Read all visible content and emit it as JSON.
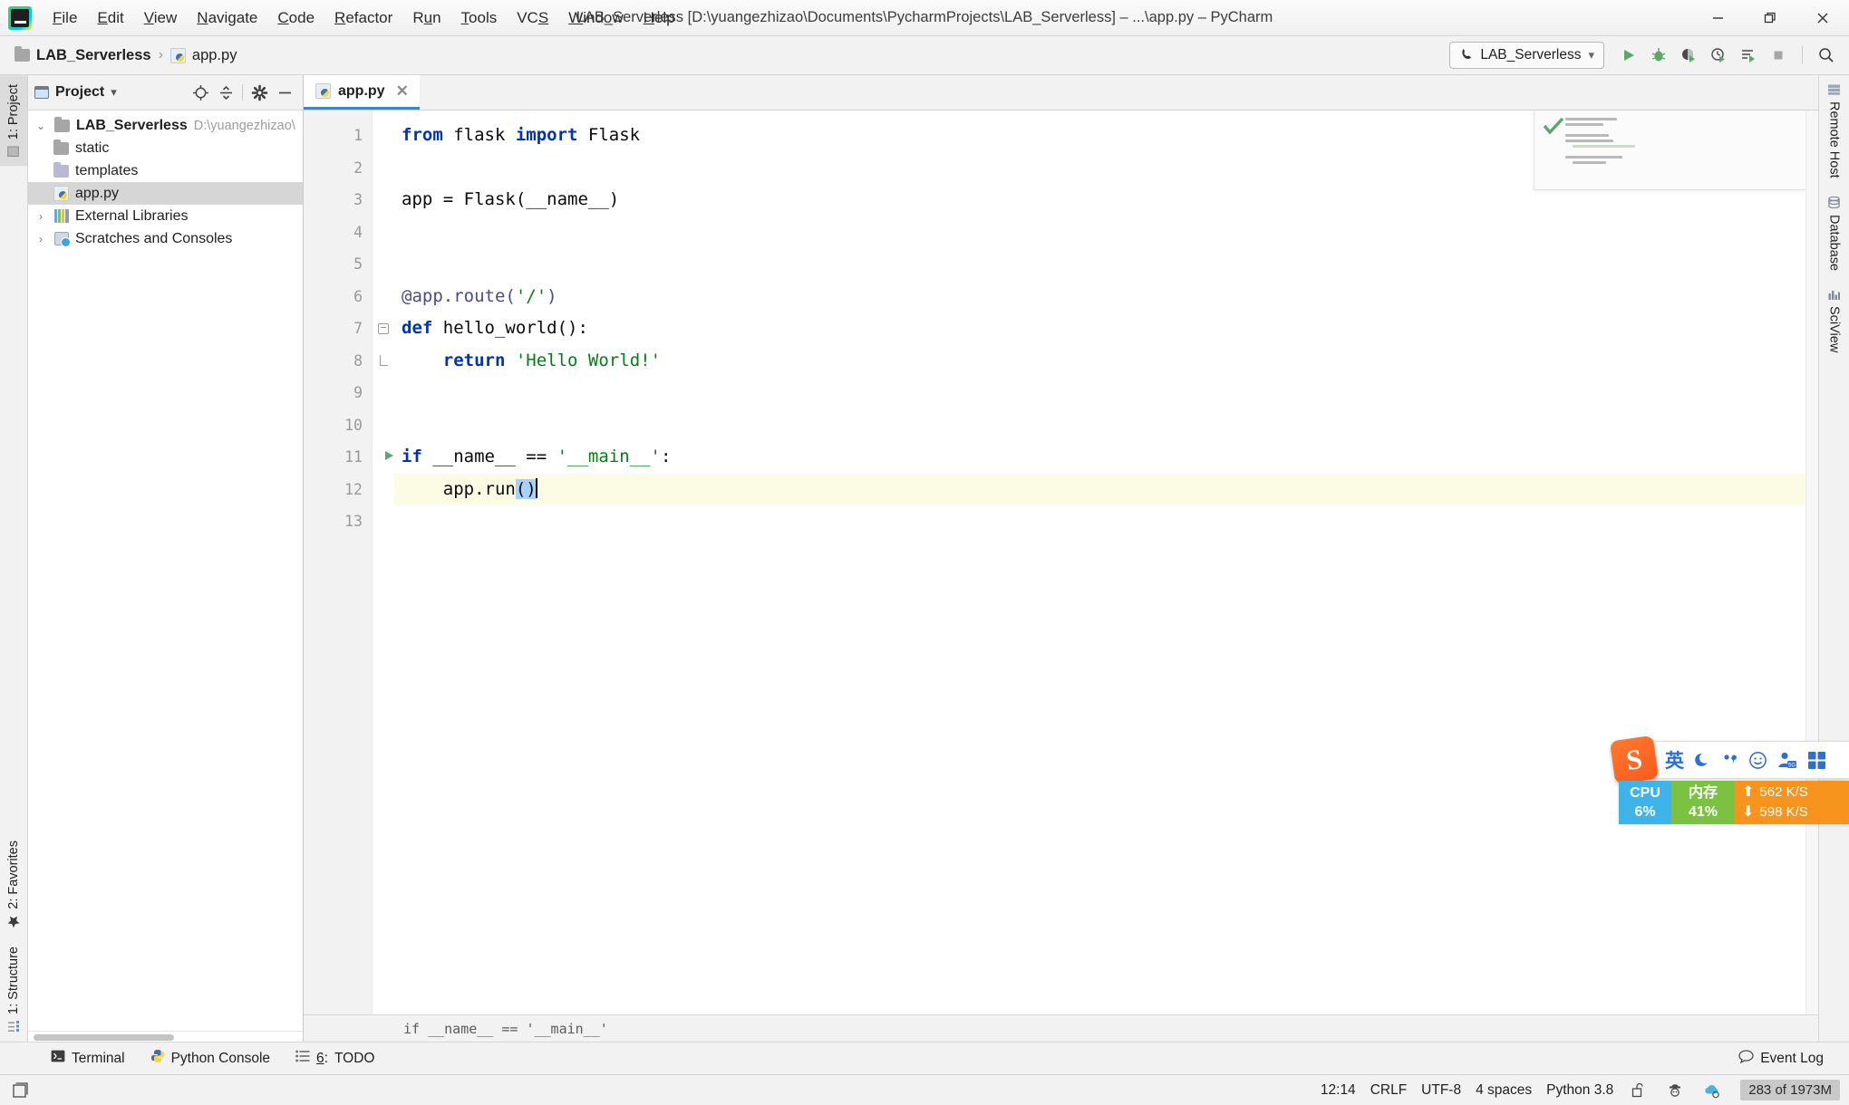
{
  "window": {
    "title": "LAB_Serverless [D:\\yuangezhizao\\Documents\\PycharmProjects\\LAB_Serverless] – ...\\app.py – PyCharm",
    "minimize": "–",
    "maximize": "❐",
    "close": "✕"
  },
  "menubar": {
    "items": [
      {
        "label": "File",
        "mnemonic": "F"
      },
      {
        "label": "Edit",
        "mnemonic": "E"
      },
      {
        "label": "View",
        "mnemonic": "V"
      },
      {
        "label": "Navigate",
        "mnemonic": "N"
      },
      {
        "label": "Code",
        "mnemonic": "C"
      },
      {
        "label": "Refactor",
        "mnemonic": "R"
      },
      {
        "label": "Run",
        "mnemonic": "u"
      },
      {
        "label": "Tools",
        "mnemonic": "T"
      },
      {
        "label": "VCS",
        "mnemonic": "S"
      },
      {
        "label": "Window",
        "mnemonic": "W"
      },
      {
        "label": "Help",
        "mnemonic": "H"
      }
    ]
  },
  "navbar": {
    "crumbs": [
      {
        "label": "LAB_Serverless",
        "icon": "folder-icon"
      },
      {
        "label": "app.py",
        "icon": "python-file-icon"
      }
    ],
    "separator": "›",
    "run_configuration": "LAB_Serverless",
    "toolbar_icons": [
      "run-icon",
      "debug-icon",
      "run-coverage-icon",
      "profile-icon",
      "run-with-console-icon",
      "stop-icon",
      "search-everywhere-icon"
    ]
  },
  "left_strip": {
    "top": [
      {
        "label": "1: Project",
        "active": true
      }
    ],
    "bottom": [
      {
        "label": "2: Favorites",
        "active": false
      },
      {
        "label": "1: Structure",
        "active": false
      }
    ]
  },
  "right_strip": {
    "items": [
      {
        "label": "Remote Host"
      },
      {
        "label": "Database"
      },
      {
        "label": "SciView"
      }
    ]
  },
  "project_panel": {
    "title": "Project",
    "dropdown_caret": "▾",
    "header_icons": [
      "locate-icon",
      "collapse-all-icon",
      "settings-gear-icon",
      "hide-icon"
    ],
    "tree": [
      {
        "label": "LAB_Serverless",
        "path": "D:\\yuangezhizao\\",
        "icon": "folder-icon",
        "twisty": "⌄",
        "indent": 0,
        "bold": true,
        "selected": false
      },
      {
        "label": "static",
        "path": "",
        "icon": "folder-icon",
        "twisty": "",
        "indent": 1,
        "bold": false,
        "selected": false
      },
      {
        "label": "templates",
        "path": "",
        "icon": "folder-blue-icon",
        "twisty": "",
        "indent": 1,
        "bold": false,
        "selected": false
      },
      {
        "label": "app.py",
        "path": "",
        "icon": "python-file-icon",
        "twisty": "",
        "indent": 1,
        "bold": false,
        "selected": true
      },
      {
        "label": "External Libraries",
        "path": "",
        "icon": "libraries-icon",
        "twisty": "›",
        "indent": 0,
        "bold": false,
        "selected": false
      },
      {
        "label": "Scratches and Consoles",
        "path": "",
        "icon": "scratches-icon",
        "twisty": "›",
        "indent": 0,
        "bold": false,
        "selected": false
      }
    ]
  },
  "editor": {
    "tabs": [
      {
        "label": "app.py",
        "close": "✕",
        "active": true
      }
    ],
    "lines": [
      {
        "n": "1",
        "highlight": false,
        "run_marker": false,
        "fold": "",
        "tokens": [
          {
            "t": "from ",
            "c": "kw"
          },
          {
            "t": "flask ",
            "c": ""
          },
          {
            "t": "import ",
            "c": "kw"
          },
          {
            "t": "Flask",
            "c": ""
          }
        ]
      },
      {
        "n": "2",
        "highlight": false,
        "run_marker": false,
        "fold": "",
        "tokens": []
      },
      {
        "n": "3",
        "highlight": false,
        "run_marker": false,
        "fold": "",
        "tokens": [
          {
            "t": "app = Flask(__name__)",
            "c": ""
          }
        ]
      },
      {
        "n": "4",
        "highlight": false,
        "run_marker": false,
        "fold": "",
        "tokens": []
      },
      {
        "n": "5",
        "highlight": false,
        "run_marker": false,
        "fold": "",
        "tokens": []
      },
      {
        "n": "6",
        "highlight": false,
        "run_marker": false,
        "fold": "",
        "tokens": [
          {
            "t": "@app.route(",
            "c": "deco"
          },
          {
            "t": "'/'",
            "c": "str"
          },
          {
            "t": ")",
            "c": "deco"
          }
        ]
      },
      {
        "n": "7",
        "highlight": false,
        "run_marker": false,
        "fold": "minus",
        "tokens": [
          {
            "t": "def ",
            "c": "kw"
          },
          {
            "t": "hello_world():",
            "c": ""
          }
        ]
      },
      {
        "n": "8",
        "highlight": false,
        "run_marker": false,
        "fold": "end",
        "tokens": [
          {
            "t": "    ",
            "c": ""
          },
          {
            "t": "return ",
            "c": "kw"
          },
          {
            "t": "'Hello World!'",
            "c": "str"
          }
        ]
      },
      {
        "n": "9",
        "highlight": false,
        "run_marker": false,
        "fold": "",
        "tokens": []
      },
      {
        "n": "10",
        "highlight": false,
        "run_marker": false,
        "fold": "",
        "tokens": []
      },
      {
        "n": "11",
        "highlight": false,
        "run_marker": true,
        "fold": "",
        "tokens": [
          {
            "t": "if ",
            "c": "kw"
          },
          {
            "t": "__name__ == ",
            "c": ""
          },
          {
            "t": "'__main__'",
            "c": "str"
          },
          {
            "t": ":",
            "c": ""
          }
        ]
      },
      {
        "n": "12",
        "highlight": true,
        "run_marker": false,
        "fold": "",
        "tokens": [
          {
            "t": "    app.run",
            "c": ""
          },
          {
            "t": "()",
            "c": "sel"
          },
          {
            "t": "|",
            "c": "caret"
          }
        ]
      },
      {
        "n": "13",
        "highlight": false,
        "run_marker": false,
        "fold": "",
        "tokens": []
      }
    ],
    "breadcrumb": "if __name__ == '__main__'",
    "inspection_status": "no-errors-check-icon"
  },
  "bottom_bar": {
    "items": [
      {
        "label": "Terminal",
        "icon": "terminal-icon",
        "mnemonic": ""
      },
      {
        "label": "Python Console",
        "icon": "python-icon",
        "mnemonic": ""
      },
      {
        "label": "TODO",
        "icon": "todo-list-icon",
        "mnemonic": "6"
      }
    ],
    "event_log": "Event Log",
    "event_log_icon": "balloon-icon"
  },
  "status_bar": {
    "caret_position": "12:14",
    "line_separator": "CRLF",
    "encoding": "UTF-8",
    "indent": "4 spaces",
    "interpreter": "Python 3.8",
    "icons": [
      "lock-open-icon",
      "inspector-hat-icon",
      "sync-cloud-icon"
    ],
    "memory": "283 of 1973M"
  },
  "ime_overlay": {
    "logo": "S",
    "mode": "英",
    "icons": [
      "moon-icon",
      "comma-icon",
      "smiley-icon",
      "user-5g-icon",
      "apps-grid-icon"
    ]
  },
  "system_monitor": {
    "cpu_label": "CPU",
    "cpu_value": "6%",
    "mem_label": "内存",
    "mem_value": "41%",
    "up_arrow": "⬆",
    "down_arrow": "⬇",
    "up_speed": "562 K/S",
    "down_speed": "598 K/S"
  },
  "colors": {
    "accent": "#4083c9",
    "keyword": "#0033b3",
    "string": "#067d17",
    "decorator": "#4a4a8f",
    "selection": "#a6d2ff",
    "highlight_line": "#fcfbe3",
    "run_green": "#59a869"
  }
}
